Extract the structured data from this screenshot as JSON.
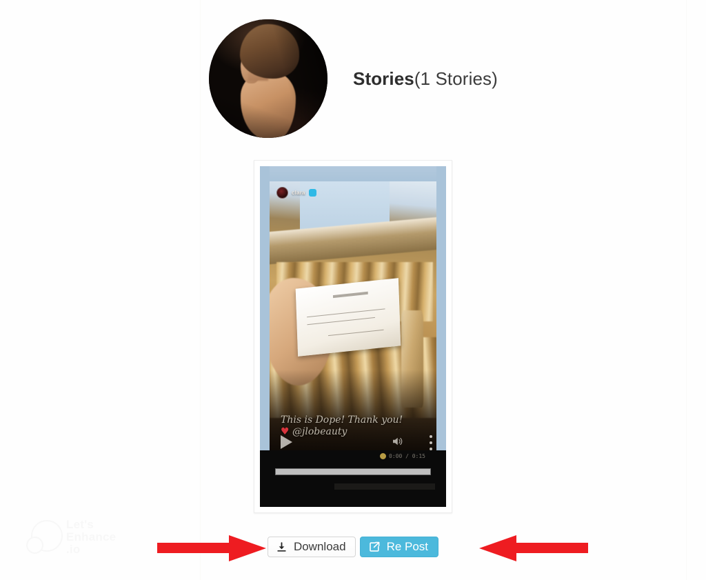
{
  "page": {
    "background_color": "#fefefe"
  },
  "header": {
    "avatar_name": "profile-avatar",
    "title_strong": "Stories",
    "title_count": "(1 Stories)"
  },
  "media": {
    "card_name": "story-media-card",
    "video": {
      "overlay_username": "clara",
      "caption_line_1": "This is Dope! Thank you!",
      "caption_heart": "♥",
      "caption_line_2": "@jlobeauty",
      "play_state": "paused",
      "progress_percent": 0,
      "time_label": "0:00 / 0:15",
      "controls": {
        "play_label": "Play",
        "sound_label": "Sound",
        "menu_label": "More options"
      }
    }
  },
  "actions": {
    "download": {
      "label": "Download",
      "icon": "download-icon"
    },
    "repost": {
      "label": "Re Post",
      "icon": "share-external-icon",
      "color": "#4cb9dc"
    }
  },
  "annotations": {
    "arrow_color": "#ee1c21",
    "left_arrow_direction": "right",
    "right_arrow_direction": "left"
  },
  "watermark": {
    "line1": "Let's",
    "line2": "Enhance",
    "line3": ".io"
  }
}
